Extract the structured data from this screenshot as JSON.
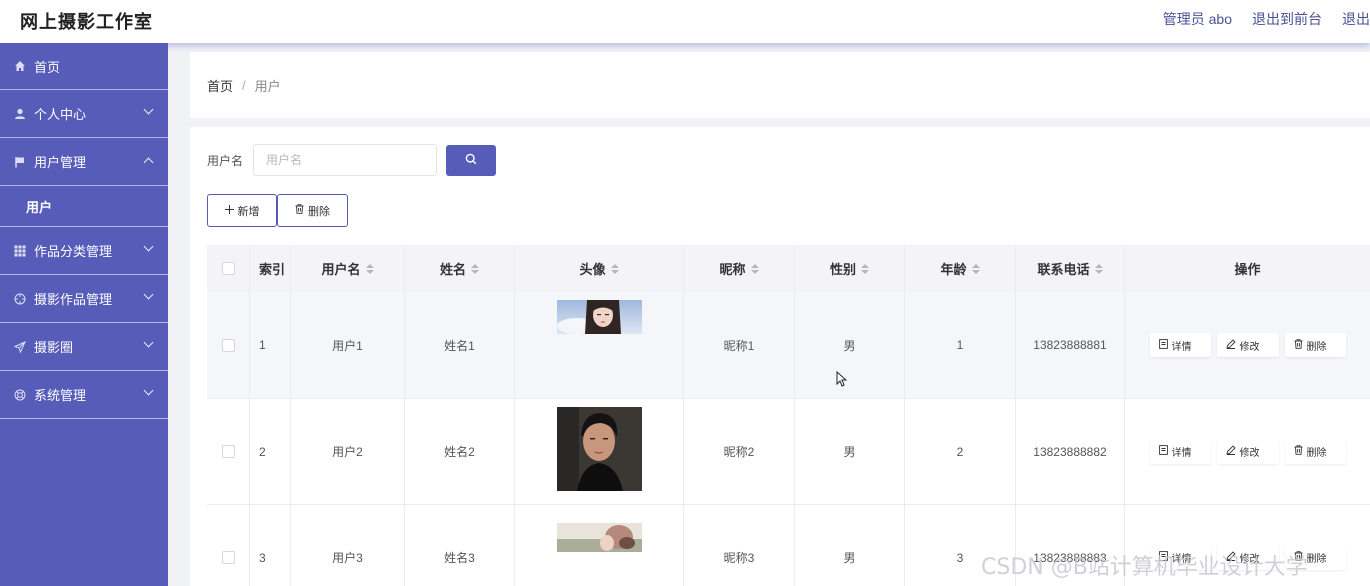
{
  "header": {
    "title": "网上摄影工作室",
    "admin_label": "管理员 abo",
    "frontend_label": "退出到前台",
    "logout_label": "退出"
  },
  "sidebar": {
    "items": [
      {
        "label": "首页",
        "icon": "home-icon"
      },
      {
        "label": "个人中心",
        "icon": "user-icon"
      },
      {
        "label": "用户管理",
        "icon": "flag-icon",
        "expanded": true
      },
      {
        "label": "用户",
        "sub": true
      },
      {
        "label": "作品分类管理",
        "icon": "grid-icon"
      },
      {
        "label": "摄影作品管理",
        "icon": "target-icon"
      },
      {
        "label": "摄影圈",
        "icon": "send-icon"
      },
      {
        "label": "系统管理",
        "icon": "lifebuoy-icon"
      }
    ]
  },
  "breadcrumb": {
    "home": "首页",
    "separator": "/",
    "current": "用户"
  },
  "search": {
    "label": "用户名",
    "placeholder": "用户名",
    "value": ""
  },
  "actions": {
    "add_label": "新增",
    "delete_label": "删除"
  },
  "table": {
    "headers": {
      "index": "索引",
      "username": "用户名",
      "name": "姓名",
      "avatar": "头像",
      "nickname": "昵称",
      "gender": "性别",
      "age": "年龄",
      "phone": "联系电话",
      "ops": "操作"
    },
    "rows": [
      {
        "index": "1",
        "username": "用户1",
        "name": "姓名1",
        "nickname": "昵称1",
        "gender": "男",
        "age": "1",
        "phone": "13823888881"
      },
      {
        "index": "2",
        "username": "用户2",
        "name": "姓名2",
        "nickname": "昵称2",
        "gender": "男",
        "age": "2",
        "phone": "13823888882"
      },
      {
        "index": "3",
        "username": "用户3",
        "name": "姓名3",
        "nickname": "昵称3",
        "gender": "男",
        "age": "3",
        "phone": "13823888883"
      }
    ],
    "row_ops": {
      "detail": "详情",
      "edit": "修改",
      "delete": "删除"
    }
  },
  "watermark": "CSDN @B站计算机毕业设计大学",
  "colors": {
    "accent": "#575cb9",
    "header_link": "#4b5195"
  }
}
